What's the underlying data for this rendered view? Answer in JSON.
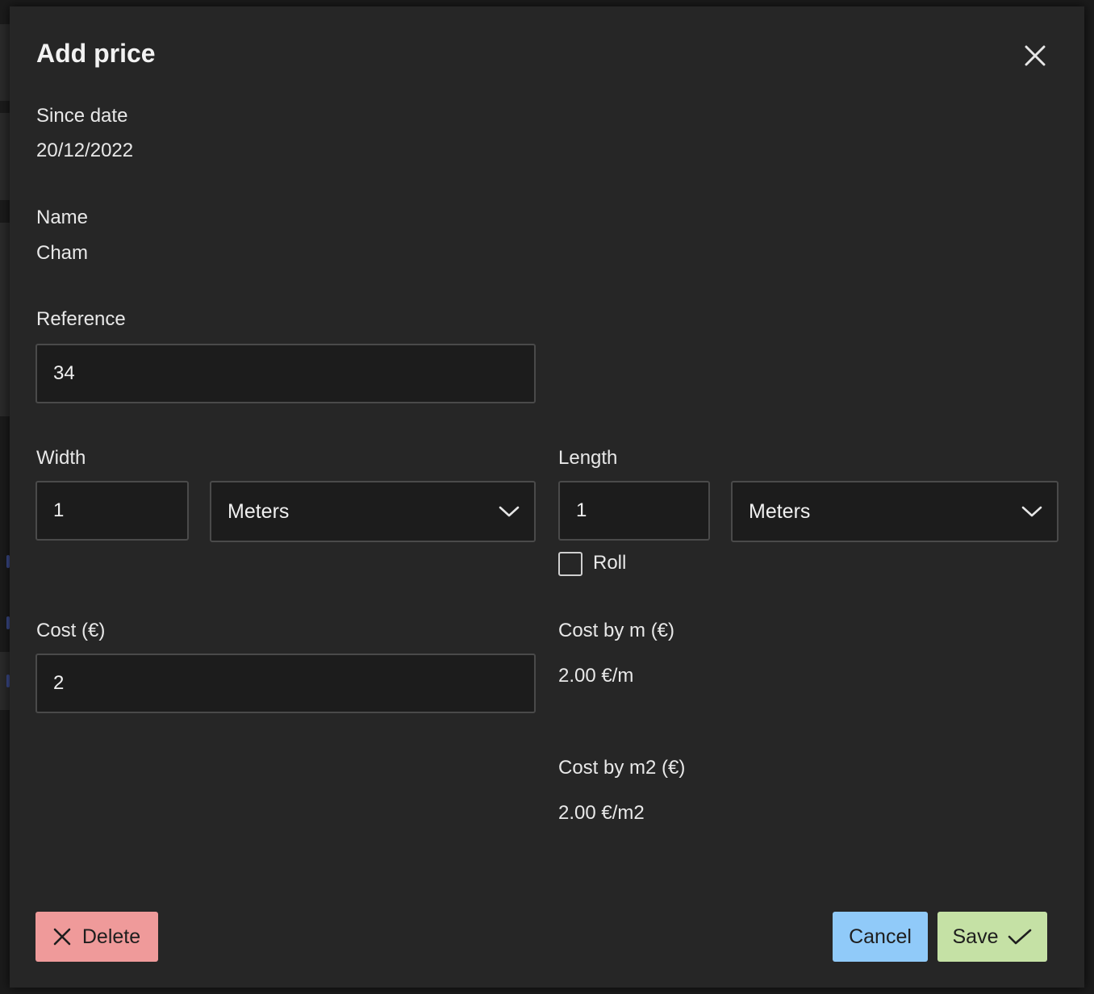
{
  "dialog": {
    "title": "Add price",
    "close_icon": "close-icon"
  },
  "since_date": {
    "label": "Since date",
    "value": "20/12/2022"
  },
  "name": {
    "label": "Name",
    "value": "Cham"
  },
  "reference": {
    "label": "Reference",
    "value": "34"
  },
  "width": {
    "label": "Width",
    "value": "1",
    "unit": "Meters"
  },
  "length": {
    "label": "Length",
    "value": "1",
    "unit": "Meters"
  },
  "roll": {
    "label": "Roll",
    "checked": false
  },
  "cost": {
    "label": "Cost (€)",
    "value": "2"
  },
  "cost_by_m": {
    "label": "Cost by m (€)",
    "value": "2.00 €/m"
  },
  "cost_by_m2": {
    "label": "Cost by m2 (€)",
    "value": "2.00 €/m2"
  },
  "actions": {
    "delete_label": "Delete",
    "cancel_label": "Cancel",
    "save_label": "Save"
  },
  "colors": {
    "dialog_bg": "#262626",
    "delete_bg": "#ef9a9a",
    "cancel_bg": "#90caf9",
    "save_bg": "#c5e1a5"
  }
}
